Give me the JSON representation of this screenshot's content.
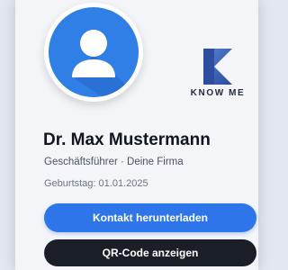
{
  "profile": {
    "name": "Dr. Max Mustermann",
    "role": "Geschäftsführer · Deine Firma",
    "birthday": "Geburtstag: 01.01.2025",
    "avatar_icon": "user-silhouette-icon",
    "avatar_color": "#2f7fe6"
  },
  "brand": {
    "logo_text": "KNOW ME",
    "logo_icon": "k-logo-icon",
    "logo_color": "#3f63b8"
  },
  "actions": {
    "download_contact": "Kontakt herunterladen",
    "show_qr": "QR-Code anzeigen",
    "primary_color": "#2e75ea",
    "dark_color": "#1a1e27"
  }
}
